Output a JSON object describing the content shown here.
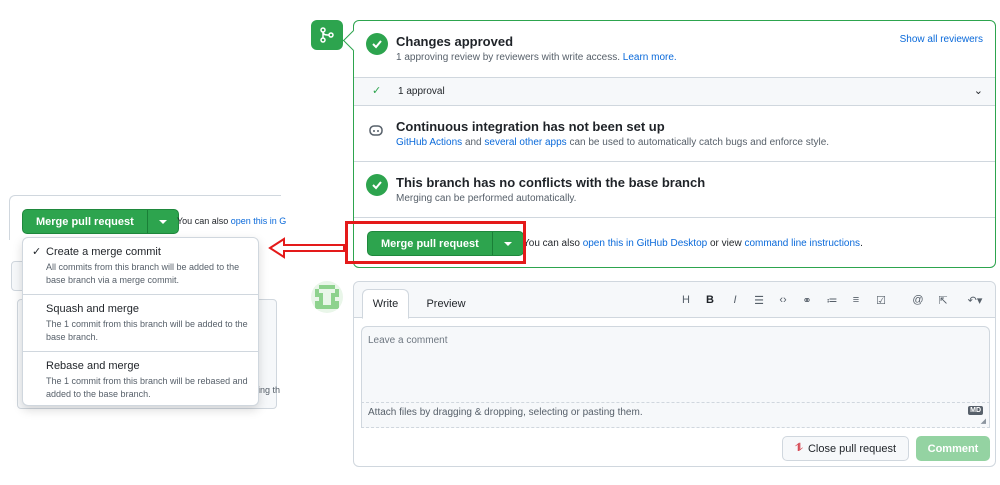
{
  "left_snippet": {
    "merge_button_label": "Merge pull request",
    "can_also_text": "You can also",
    "open_link_partial": "open this in G",
    "cut_text": "ing th",
    "menu_items": [
      {
        "title": "Create a merge commit",
        "description": "All commits from this branch will be added to the base branch via a merge commit.",
        "checked": true
      },
      {
        "title": "Squash and merge",
        "description": "The 1 commit from this branch will be added to the base branch.",
        "checked": false
      },
      {
        "title": "Rebase and merge",
        "description": "The 1 commit from this branch will be rebased and added to the base branch.",
        "checked": false
      }
    ]
  },
  "merge_box": {
    "approved": {
      "title": "Changes approved",
      "subtitle": "1 approving review by reviewers with write access.",
      "learn_more": "Learn more.",
      "show_all": "Show all reviewers"
    },
    "approval_row": "1 approval",
    "ci": {
      "title": "Continuous integration has not been set up",
      "link1": "GitHub Actions",
      "mid": "and",
      "link2": "several other apps",
      "rest": "can be used to automatically catch bugs and enforce style."
    },
    "conflicts": {
      "title": "This branch has no conflicts with the base branch",
      "subtitle": "Merging can be performed automatically."
    },
    "merge_button_label": "Merge pull request",
    "can_also_text": "You can also",
    "desktop_link": "open this in GitHub Desktop",
    "or_view": "or view",
    "cli_link": "command line instructions",
    "period": "."
  },
  "comment": {
    "tab_write": "Write",
    "tab_preview": "Preview",
    "toolbar": [
      "H",
      "B",
      "I"
    ],
    "placeholder": "Leave a comment",
    "attach_text": "Attach files by dragging & dropping, selecting or pasting them.",
    "md_badge": "MD",
    "close_button": "Close pull request",
    "comment_button": "Comment"
  },
  "colors": {
    "accent": "#2da44e",
    "link": "#0969da",
    "annotation": "#e41a1a"
  }
}
